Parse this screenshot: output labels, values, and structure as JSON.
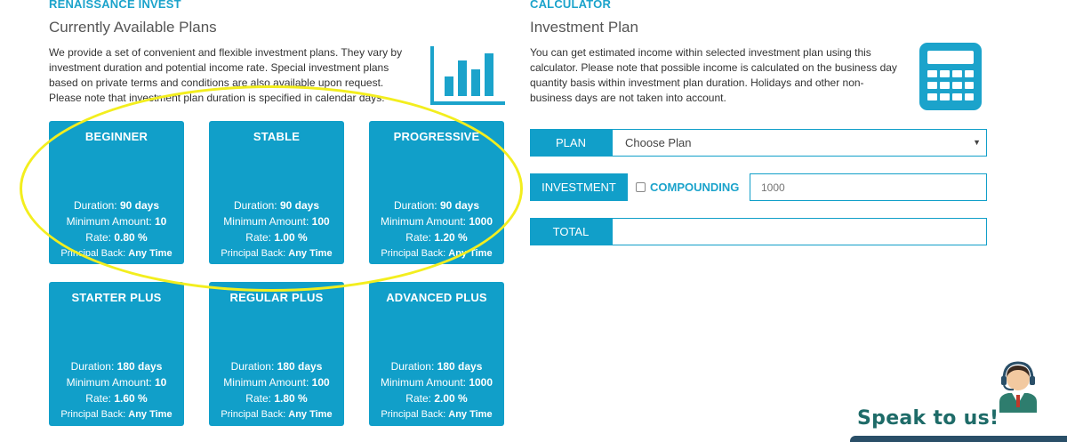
{
  "left": {
    "tag": "RENAISSANCE INVEST",
    "title": "Currently Available Plans",
    "description_lines": [
      "We provide a set of convenient and flexible investment plans. They vary by",
      "investment duration and potential income rate. Special investment plans",
      "based on private terms and conditions are also available upon request.",
      "Please note that investment plan duration is specified in calendar days."
    ],
    "icon": "bar-chart-icon"
  },
  "plans": [
    {
      "name": "BEGINNER",
      "duration_label": "Duration:",
      "duration": "90 days",
      "min_label": "Minimum Amount:",
      "min": "10",
      "rate_label": "Rate:",
      "rate": "0.80 %",
      "pb_label": "Principal Back:",
      "pb": "Any Time"
    },
    {
      "name": "STABLE",
      "duration_label": "Duration:",
      "duration": "90 days",
      "min_label": "Minimum Amount:",
      "min": "100",
      "rate_label": "Rate:",
      "rate": "1.00 %",
      "pb_label": "Principal Back:",
      "pb": "Any Time"
    },
    {
      "name": "PROGRESSIVE",
      "duration_label": "Duration:",
      "duration": "90 days",
      "min_label": "Minimum Amount:",
      "min": "1000",
      "rate_label": "Rate:",
      "rate": "1.20 %",
      "pb_label": "Principal Back:",
      "pb": "Any Time"
    },
    {
      "name": "STARTER PLUS",
      "duration_label": "Duration:",
      "duration": "180 days",
      "min_label": "Minimum Amount:",
      "min": "10",
      "rate_label": "Rate:",
      "rate": "1.60 %",
      "pb_label": "Principal Back:",
      "pb": "Any Time"
    },
    {
      "name": "REGULAR PLUS",
      "duration_label": "Duration:",
      "duration": "180 days",
      "min_label": "Minimum Amount:",
      "min": "100",
      "rate_label": "Rate:",
      "rate": "1.80 %",
      "pb_label": "Principal Back:",
      "pb": "Any Time"
    },
    {
      "name": "ADVANCED PLUS",
      "duration_label": "Duration:",
      "duration": "180 days",
      "min_label": "Minimum Amount:",
      "min": "1000",
      "rate_label": "Rate:",
      "rate": "2.00 %",
      "pb_label": "Principal Back:",
      "pb": "Any Time"
    }
  ],
  "calculator": {
    "tag": "CALCULATOR",
    "title": "Investment Plan",
    "description_lines": [
      "You can get estimated income within selected investment plan using this",
      "calculator. Please note that possible income is calculated on the business day",
      "quantity basis within investment plan duration. Holidays and other non-",
      "business days are not taken into account."
    ],
    "icon": "calculator-icon",
    "plan_label": "PLAN",
    "plan_selected": "Choose Plan",
    "investment_label": "INVESTMENT",
    "compounding_label": "COMPOUNDING",
    "compounding_checked": false,
    "amount_placeholder": "1000",
    "total_label": "TOTAL",
    "total_value": ""
  },
  "support": {
    "text": "Speak to us!",
    "icon": "support-agent-icon"
  },
  "colors": {
    "accent": "#119fc9",
    "highlight": "#f3ee1e",
    "support_text": "#1e6b68"
  }
}
